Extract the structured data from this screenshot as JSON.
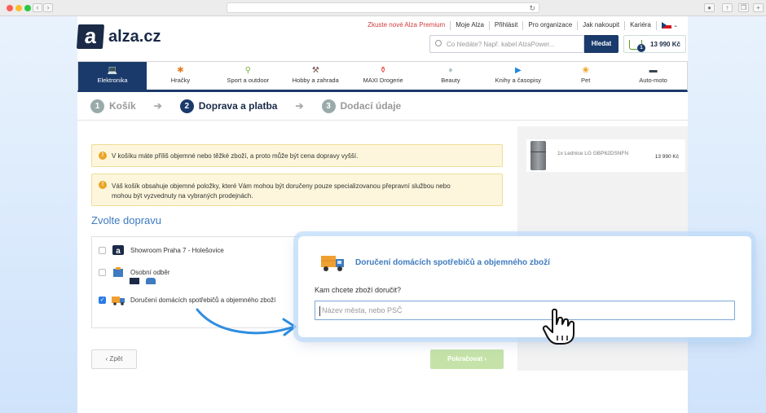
{
  "browser": {
    "traffic_lights": [
      "#ff5f57",
      "#febc2e",
      "#28c840"
    ]
  },
  "header": {
    "logo_text": "alza.cz",
    "top_links": [
      "Zkuste nové Alza Premium",
      "Moje Alza",
      "Přihlásit",
      "Pro organizace",
      "Jak nakoupit",
      "Kariéra"
    ],
    "search_placeholder": "Co hledáte? Např. kabel AlzaPower...",
    "search_button": "Hledat",
    "cart_count": "1",
    "cart_price": "13 990 Kč"
  },
  "categories": [
    {
      "label": "Elektronika",
      "icon": "laptop-icon"
    },
    {
      "label": "Hračky",
      "icon": "toy-icon"
    },
    {
      "label": "Sport a outdoor",
      "icon": "bike-icon"
    },
    {
      "label": "Hobby a zahrada",
      "icon": "drill-icon"
    },
    {
      "label": "MAXI Drogerie",
      "icon": "spray-icon"
    },
    {
      "label": "Beauty",
      "icon": "perfume-icon"
    },
    {
      "label": "Knihy a časopisy",
      "icon": "play-icon"
    },
    {
      "label": "Pet",
      "icon": "paw-icon"
    },
    {
      "label": "Auto-moto",
      "icon": "car-icon"
    }
  ],
  "steps": [
    {
      "num": "1",
      "label": "Košík"
    },
    {
      "num": "2",
      "label": "Doprava a platba"
    },
    {
      "num": "3",
      "label": "Dodací údaje"
    }
  ],
  "notices": [
    "V košíku máte příliš objemné nebo těžké zboží, a proto může být cena dopravy vyšší.",
    "Váš košík obsahuje objemné položky, které Vám mohou být doručeny pouze specializovanou přepravní službou nebo",
    "mohou být vyzvednuty na vybraných prodejnách."
  ],
  "shipping": {
    "heading": "Zvolte dopravu",
    "options": [
      {
        "label": "Showroom Praha 7 - Holešovice",
        "checked": false
      },
      {
        "label": "Osobní odběr",
        "checked": false
      },
      {
        "label": "Doručení domácích spotřebičů a objemného zboží",
        "checked": true
      }
    ]
  },
  "summary": {
    "item": "1x Lednice LG GBP62DSNFN",
    "price": "13 990 Kč"
  },
  "buttons": {
    "back": "‹ Zpět",
    "next": "Pokračovat ›"
  },
  "popup": {
    "title": "Doručení domácích spotřebičů a objemného zboží",
    "label": "Kam chcete zboží doručit?",
    "placeholder": "Název města, nebo PSČ"
  }
}
